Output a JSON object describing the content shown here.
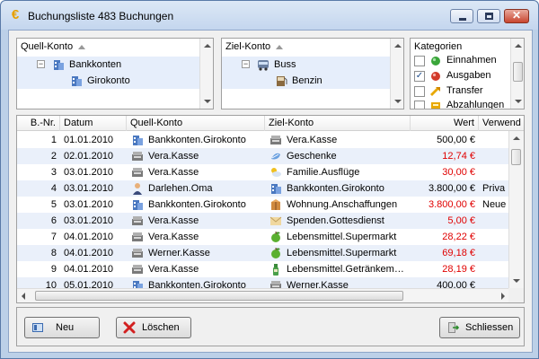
{
  "window": {
    "title": "Buchungsliste 483 Buchungen",
    "close_symbol": "✕"
  },
  "source_panel": {
    "header": "Quell-Konto",
    "nodes": [
      {
        "label": "Bankkonten",
        "icon": "bank-icon"
      },
      {
        "label": "Girokonto",
        "icon": "bank-icon"
      }
    ]
  },
  "target_panel": {
    "header": "Ziel-Konto",
    "nodes": [
      {
        "label": "Buss",
        "icon": "bus-icon"
      },
      {
        "label": "Benzin",
        "icon": "fuel-icon"
      }
    ]
  },
  "categories_panel": {
    "header": "Kategorien",
    "items": [
      {
        "label": "Einnahmen",
        "checked": false,
        "icon": "green-dot-icon"
      },
      {
        "label": "Ausgaben",
        "checked": true,
        "icon": "red-dot-icon"
      },
      {
        "label": "Transfer",
        "checked": false,
        "icon": "transfer-icon"
      },
      {
        "label": "Abzahlungen",
        "checked": false,
        "icon": "payment-icon"
      }
    ]
  },
  "table": {
    "columns": [
      "B.-Nr.",
      "Datum",
      "Quell-Konto",
      "Ziel-Konto",
      "Wert",
      "Verwend"
    ],
    "rows": [
      {
        "nr": "1",
        "date": "01.01.2010",
        "source": "Bankkonten.Girokonto",
        "source_icon": "bank-icon",
        "target": "Vera.Kasse",
        "target_icon": "cashbox-icon",
        "value": "500,00 €",
        "negative": false,
        "usage": ""
      },
      {
        "nr": "2",
        "date": "02.01.2010",
        "source": "Vera.Kasse",
        "source_icon": "cashbox-icon",
        "target": "Geschenke",
        "target_icon": "gift-icon",
        "value": "12,74 €",
        "negative": true,
        "usage": ""
      },
      {
        "nr": "3",
        "date": "03.01.2010",
        "source": "Vera.Kasse",
        "source_icon": "cashbox-icon",
        "target": "Familie.Ausflüge",
        "target_icon": "weather-icon",
        "value": "30,00 €",
        "negative": true,
        "usage": ""
      },
      {
        "nr": "4",
        "date": "03.01.2010",
        "source": "Darlehen.Oma",
        "source_icon": "person-icon",
        "target": "Bankkonten.Girokonto",
        "target_icon": "bank-icon",
        "value": "3.800,00 €",
        "negative": false,
        "usage": "Priva"
      },
      {
        "nr": "5",
        "date": "03.01.2010",
        "source": "Bankkonten.Girokonto",
        "source_icon": "bank-icon",
        "target": "Wohnung.Anschaffungen",
        "target_icon": "box-icon",
        "value": "3.800,00 €",
        "negative": true,
        "usage": "Neue"
      },
      {
        "nr": "6",
        "date": "03.01.2010",
        "source": "Vera.Kasse",
        "source_icon": "cashbox-icon",
        "target": "Spenden.Gottesdienst",
        "target_icon": "donation-icon",
        "value": "5,00 €",
        "negative": true,
        "usage": ""
      },
      {
        "nr": "7",
        "date": "04.01.2010",
        "source": "Vera.Kasse",
        "source_icon": "cashbox-icon",
        "target": "Lebensmittel.Supermarkt",
        "target_icon": "apple-icon",
        "value": "28,22 €",
        "negative": true,
        "usage": ""
      },
      {
        "nr": "8",
        "date": "04.01.2010",
        "source": "Werner.Kasse",
        "source_icon": "cashbox-icon",
        "target": "Lebensmittel.Supermarkt",
        "target_icon": "apple-icon",
        "value": "69,18 €",
        "negative": true,
        "usage": ""
      },
      {
        "nr": "9",
        "date": "04.01.2010",
        "source": "Vera.Kasse",
        "source_icon": "cashbox-icon",
        "target": "Lebensmittel.Getränkem…",
        "target_icon": "bottle-icon",
        "value": "28,19 €",
        "negative": true,
        "usage": ""
      },
      {
        "nr": "10",
        "date": "05.01.2010",
        "source": "Bankkonten.Girokonto",
        "source_icon": "bank-icon",
        "target": "Werner.Kasse",
        "target_icon": "cashbox-icon",
        "value": "400,00 €",
        "negative": false,
        "usage": ""
      }
    ]
  },
  "buttons": {
    "new": "Neu",
    "delete": "Löschen",
    "close": "Schliessen"
  },
  "colors": {
    "negative_value": "#e00000",
    "selection": "#e6eefb",
    "alt_row": "#eaf0fa"
  }
}
